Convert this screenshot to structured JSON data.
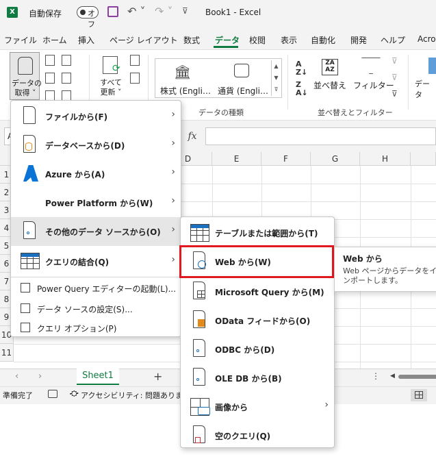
{
  "title_bar": {
    "logo": "X",
    "autosave_label": "自動保存",
    "autosave_state": "オフ",
    "title": "Book1  -  Excel"
  },
  "tabs": [
    "ファイル",
    "ホーム",
    "挿入",
    "ページ レイアウト",
    "数式",
    "データ",
    "校閲",
    "表示",
    "自動化",
    "開発",
    "ヘルプ",
    "Acro"
  ],
  "active_tab": "データ",
  "ribbon": {
    "get_data_label": "データの\n取得 ˅",
    "refresh_label": "すべて\n更新 ˅",
    "stock_label": "株式 (Engli…",
    "currency_label": "通貨 (Engli…",
    "datatype_group": "データの種類",
    "sort_label": "並べ替え",
    "filter_label": "フィルター",
    "sort_filter_group": "並べ替えとフィルター",
    "right_label": "データ"
  },
  "formula_bar": {
    "namebox": "A",
    "fx": "fx"
  },
  "columns": [
    "D",
    "E",
    "F",
    "G",
    "H"
  ],
  "rows": [
    "1",
    "2",
    "3",
    "4",
    "5",
    "6",
    "7",
    "8",
    "9",
    "10",
    "11"
  ],
  "sheets": {
    "active": "Sheet1",
    "add": "+"
  },
  "status": {
    "ready": "準備完了",
    "accessibility": "アクセシビリティ: 問題ありません"
  },
  "menu": {
    "items": [
      {
        "label": "ファイルから(F)"
      },
      {
        "label": "データベースから(D)"
      },
      {
        "label": "Azure から(A)"
      },
      {
        "label": "Power Platform から(W)"
      },
      {
        "label": "その他のデータ ソースから(O)"
      },
      {
        "label": "クエリの結合(Q)"
      }
    ],
    "small_items": [
      {
        "label": "Power Query エディターの起動(L)..."
      },
      {
        "label": "データ ソースの設定(S)..."
      },
      {
        "label": "クエリ オプション(P)"
      }
    ]
  },
  "submenu": {
    "items": [
      {
        "label": "テーブルまたは範囲から(T)"
      },
      {
        "label": "Web から(W)"
      },
      {
        "label": "Microsoft Query から(M)"
      },
      {
        "label": "OData フィードから(O)"
      },
      {
        "label": "ODBC から(D)"
      },
      {
        "label": "OLE DB から(B)"
      },
      {
        "label": "画像から"
      },
      {
        "label": "空のクエリ(Q)"
      }
    ]
  },
  "tooltip": {
    "title": "Web から",
    "desc": "Web ページからデータをインポートします。"
  },
  "colors": {
    "accent": "#107c41",
    "highlight": "#e0181f",
    "link_blue": "#1a6fbf"
  }
}
